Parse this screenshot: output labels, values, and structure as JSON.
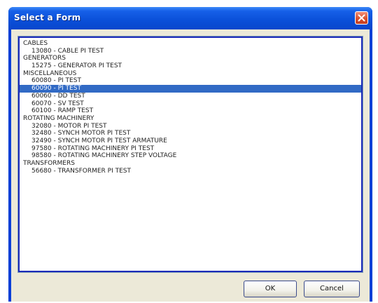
{
  "window": {
    "title": "Select a Form"
  },
  "list": {
    "items": [
      {
        "label": "CABLES",
        "kind": "category",
        "selected": false
      },
      {
        "label": "13080 - CABLE PI TEST",
        "kind": "child",
        "selected": false
      },
      {
        "label": "GENERATORS",
        "kind": "category",
        "selected": false
      },
      {
        "label": "15275 - GENERATOR PI TEST",
        "kind": "child",
        "selected": false
      },
      {
        "label": "MISCELLANEOUS",
        "kind": "category",
        "selected": false
      },
      {
        "label": "60080 - PI TEST",
        "kind": "child",
        "selected": false
      },
      {
        "label": "60090 - PI TEST",
        "kind": "child",
        "selected": true
      },
      {
        "label": "60060 - DD TEST",
        "kind": "child",
        "selected": false
      },
      {
        "label": "60070 - SV TEST",
        "kind": "child",
        "selected": false
      },
      {
        "label": "60100 - RAMP TEST",
        "kind": "child",
        "selected": false
      },
      {
        "label": "ROTATING MACHINERY",
        "kind": "category",
        "selected": false
      },
      {
        "label": "32080 - MOTOR PI TEST",
        "kind": "child",
        "selected": false
      },
      {
        "label": "32480 - SYNCH MOTOR PI TEST",
        "kind": "child",
        "selected": false
      },
      {
        "label": "32490 - SYNCH MOTOR PI TEST ARMATURE",
        "kind": "child",
        "selected": false
      },
      {
        "label": "97580 - ROTATING MACHINERY PI TEST",
        "kind": "child",
        "selected": false
      },
      {
        "label": "98580 - ROTATING MACHINERY STEP VOLTAGE",
        "kind": "child",
        "selected": false
      },
      {
        "label": "TRANSFORMERS",
        "kind": "category",
        "selected": false
      },
      {
        "label": "56680 - TRANSFORMER PI TEST",
        "kind": "child",
        "selected": false
      }
    ]
  },
  "buttons": {
    "ok": "OK",
    "cancel": "Cancel"
  },
  "colors": {
    "title_bar": "#0a4fd8",
    "selection": "#316ac5",
    "dialog_face": "#ece9d8",
    "close_button": "#d9502e"
  },
  "icons": {
    "close": "close-icon"
  }
}
